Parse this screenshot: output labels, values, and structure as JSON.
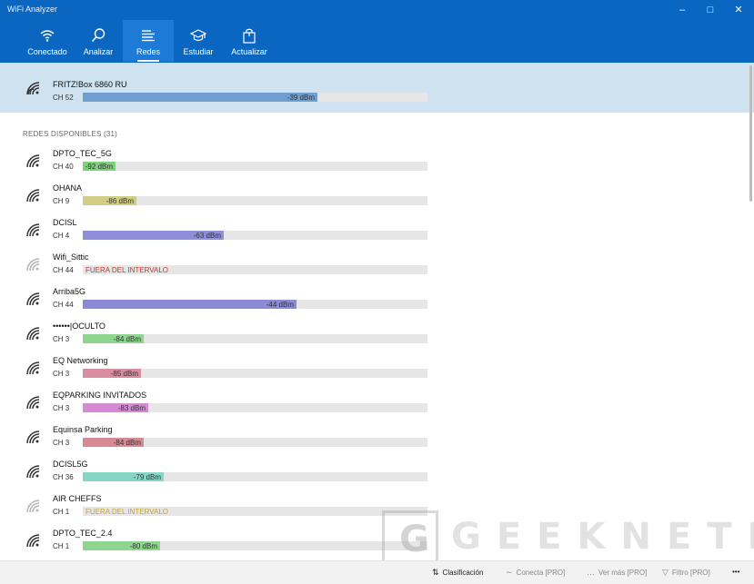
{
  "app": {
    "title": "WiFi Analyzer"
  },
  "nav": [
    {
      "label": "Conectado",
      "icon": "wifi-icon"
    },
    {
      "label": "Analizar",
      "icon": "magnifier-icon"
    },
    {
      "label": "Redes",
      "icon": "list-icon",
      "active": true
    },
    {
      "label": "Estudiar",
      "icon": "graduation-cap-icon"
    },
    {
      "label": "Actualizar",
      "icon": "shopping-bag-icon"
    }
  ],
  "connected": {
    "ssid": "FRITZ!Box 6860 RU",
    "channel": "CH 52",
    "signal": "-39 dBm",
    "level": 0.68,
    "color": "#6f9fd0"
  },
  "available": {
    "label": "REDES DISPONIBLES (31)",
    "networks": [
      {
        "ssid": "DPTO_TEC_5G",
        "channel": "CH 40",
        "signal": "-92 dBm",
        "level": 0.095,
        "color": "#7ecf7e"
      },
      {
        "ssid": "OHANA",
        "channel": "CH 9",
        "signal": "-86 dBm",
        "level": 0.155,
        "color": "#d3cc86"
      },
      {
        "ssid": "DCISL",
        "channel": "CH 4",
        "signal": "-63 dBm",
        "level": 0.41,
        "color": "#8f8fd8"
      },
      {
        "ssid": "Wifi_Sittic",
        "channel": "CH 44",
        "out_of_range": "FUERA DEL INTERVALO",
        "out_color": "#c0392b"
      },
      {
        "ssid": "Arriba5G",
        "channel": "CH 44",
        "signal": "-44 dBm",
        "level": 0.62,
        "color": "#8a8ad6"
      },
      {
        "ssid": "••••••|OCULTO",
        "channel": "CH 3",
        "signal": "-84 dBm",
        "level": 0.178,
        "color": "#8fd48f"
      },
      {
        "ssid": "EQ Networking",
        "channel": "CH 3",
        "signal": "-85 dBm",
        "level": 0.168,
        "color": "#d88ca0"
      },
      {
        "ssid": "EQPARKING INVITADOS",
        "channel": "CH 3",
        "signal": "-83 dBm",
        "level": 0.19,
        "color": "#d68ad6"
      },
      {
        "ssid": "Equinsa Parking",
        "channel": "CH 3",
        "signal": "-84 dBm",
        "level": 0.178,
        "color": "#d68a94"
      },
      {
        "ssid": "DCISL5G",
        "channel": "CH 36",
        "signal": "-79 dBm",
        "level": 0.235,
        "color": "#86d6c8"
      },
      {
        "ssid": "AIR CHEFFS",
        "channel": "CH 1",
        "out_of_range": "FUERA DEL INTERVALO",
        "out_color": "#c9a227"
      },
      {
        "ssid": "DPTO_TEC_2.4",
        "channel": "CH 1",
        "signal": "-80 dBm",
        "level": 0.224,
        "color": "#8fd48f"
      }
    ]
  },
  "bottom": [
    {
      "label": "Clasificación",
      "icon": "sort-icon",
      "enabled": true
    },
    {
      "label": "Conecta [PRO]",
      "icon": "connect-icon",
      "enabled": false
    },
    {
      "label": "Ver más [PRO]",
      "icon": "view-more-icon",
      "enabled": false
    },
    {
      "label": "Filtro [PRO]",
      "icon": "filter-icon",
      "enabled": false
    },
    {
      "label": "•••",
      "icon": "more-icon",
      "enabled": true
    }
  ],
  "watermark": {
    "text": "GEEKNETIC"
  }
}
